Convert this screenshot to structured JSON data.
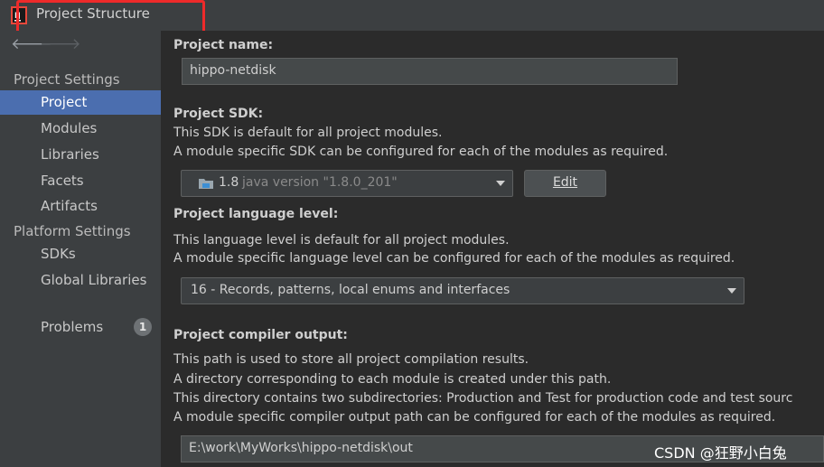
{
  "window": {
    "title": "Project Structure"
  },
  "sidebar": {
    "project_settings_label": "Project Settings",
    "platform_settings_label": "Platform Settings",
    "items": [
      {
        "label": "Project"
      },
      {
        "label": "Modules"
      },
      {
        "label": "Libraries"
      },
      {
        "label": "Facets"
      },
      {
        "label": "Artifacts"
      },
      {
        "label": "SDKs"
      },
      {
        "label": "Global Libraries"
      },
      {
        "label": "Problems",
        "badge": "1"
      }
    ]
  },
  "project": {
    "name_label": "Project name:",
    "name_value": "hippo-netdisk",
    "sdk_label": "Project SDK:",
    "sdk_desc1": "This SDK is default for all project modules.",
    "sdk_desc2": "A module specific SDK can be configured for each of the modules as required.",
    "sdk_value": "1.8",
    "sdk_detail": "java version \"1.8.0_201\"",
    "edit_button": "Edit",
    "lang_label": "Project language level:",
    "lang_desc1": "This language level is default for all project modules.",
    "lang_desc2": "A module specific language level can be configured for each of the modules as required.",
    "lang_value": "16 - Records, patterns, local enums and interfaces",
    "output_label": "Project compiler output:",
    "output_desc1": "This path is used to store all project compilation results.",
    "output_desc2": "A directory corresponding to each module is created under this path.",
    "output_desc3": "This directory contains two subdirectories: Production and Test for production code and test sourc",
    "output_desc4": "A module specific compiler output path can be configured for each of the modules as required.",
    "output_value": "E:\\work\\MyWorks\\hippo-netdisk\\out"
  },
  "watermark": "CSDN @狂野小白兔",
  "colors": {
    "selection": "#4b6eaf",
    "annotation": "#ee2a2a",
    "background": "#2b2b2b"
  }
}
